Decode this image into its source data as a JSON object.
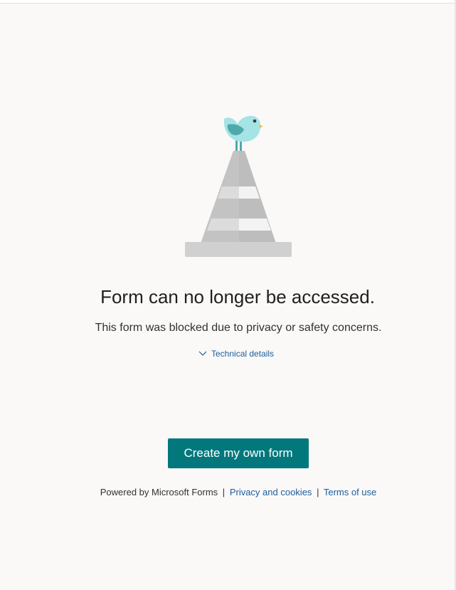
{
  "page": {
    "headline": "Form can no longer be accessed.",
    "message": "This form was blocked due to privacy or safety concerns.",
    "technical_details_label": "Technical details",
    "create_button_label": "Create my own form"
  },
  "footer": {
    "powered_by": "Powered by Microsoft Forms",
    "separator": "|",
    "privacy_link": "Privacy and cookies",
    "terms_link": "Terms of use"
  },
  "colors": {
    "background": "#faf9f8",
    "accent": "#03787c",
    "link": "#1d5d9b",
    "bird": "#a6e3e4"
  },
  "icons": {
    "illustration": "traffic-cone-with-bird",
    "details_toggle": "chevron-down-icon"
  }
}
